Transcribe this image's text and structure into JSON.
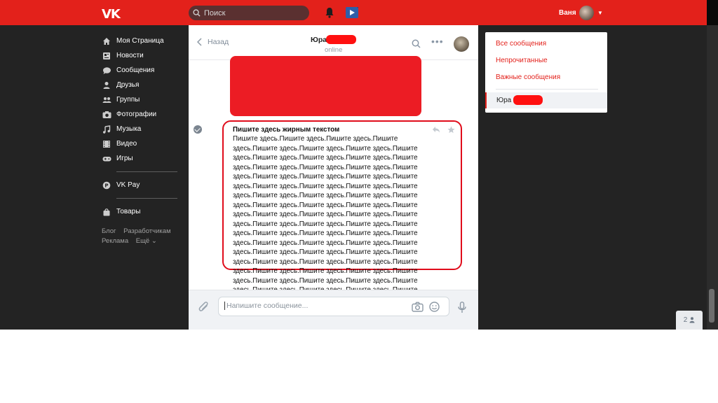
{
  "topbar": {
    "logo": "VK",
    "search_placeholder": "Поиск",
    "user_name": "Ваня",
    "brand_color": "#e3211b"
  },
  "left_menu": {
    "items": [
      {
        "label": "Моя Страница",
        "icon": "home-icon"
      },
      {
        "label": "Новости",
        "icon": "news-icon"
      },
      {
        "label": "Сообщения",
        "icon": "messages-icon"
      },
      {
        "label": "Друзья",
        "icon": "friend-icon"
      },
      {
        "label": "Группы",
        "icon": "groups-icon"
      },
      {
        "label": "Фотографии",
        "icon": "camera-icon"
      },
      {
        "label": "Музыка",
        "icon": "music-icon"
      },
      {
        "label": "Видео",
        "icon": "film-icon"
      },
      {
        "label": "Игры",
        "icon": "gamepad-icon"
      }
    ],
    "pay_label": "VK Pay",
    "goods_label": "Товары",
    "footer": [
      "Блог",
      "Разработчикам",
      "Реклама",
      "Ещё ⌄"
    ]
  },
  "chat": {
    "back_label": "Назад",
    "peer_name": "Юра",
    "peer_status": "online",
    "message_title": "Пишите здесь жирным текстом",
    "message_text": "Пишите здесь.Пишите здесь.Пишите здесь.Пишите здесь.Пишите здесь.Пишите здесь.Пишите здесь.Пишите здесь.Пишите здесь.Пишите здесь.Пишите здесь.Пишите здесь.Пишите здесь.Пишите здесь.Пишите здесь.Пишите здесь.Пишите здесь.Пишите здесь.Пишите здесь.Пишите здесь.Пишите здесь.Пишите здесь.Пишите здесь.Пишите здесь.Пишите здесь.Пишите здесь.Пишите здесь.Пишите здесь.Пишите здесь.Пишите здесь.Пишите здесь.Пишите здесь.Пишите здесь.Пишите здесь.Пишите здесь.Пишите здесь.Пишите здесь.Пишите здесь.Пишите здесь.Пишите здесь.Пишите здесь.Пишите здесь.Пишите здесь.Пишите здесь.Пишите здесь.Пишите здесь.Пишите здесь.Пишите здесь.Пишите здесь.Пишите здесь.Пишите здесь.Пишите здесь.Пишите здесь.Пишите здесь.Пишите здесь.Пишите здесь.Пишите здесь.Пишите здесь.Пишите здесь.Пишите здесь.Пишите здесь.Пишите здесь.Пишите здесь.Пишите здесь.Пишите здесь.Пишите здесь.Пишите здесь.Пишите здесь.Пишите здесь.",
    "composer_placeholder": "Напишите сообщение..."
  },
  "filters": {
    "all": "Все сообщения",
    "unread": "Непрочитанные",
    "important": "Важные сообщения",
    "active_name": "Юра"
  },
  "badge": {
    "count": "2"
  }
}
